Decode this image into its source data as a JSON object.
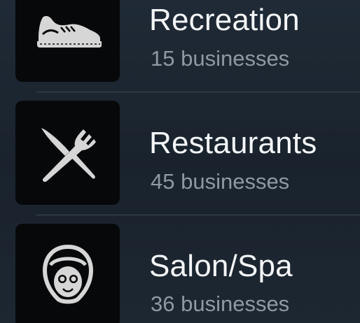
{
  "categories": [
    {
      "title": "Recreation",
      "count": "15 businesses",
      "icon": "shoe-icon"
    },
    {
      "title": "Restaurants",
      "count": "45 businesses",
      "icon": "fork-knife-icon"
    },
    {
      "title": "Salon/Spa",
      "count": "36 businesses",
      "icon": "spa-face-mask-icon"
    }
  ],
  "colors": {
    "background": "#1d2731",
    "tile": "#06080a",
    "icon": "#d6d6d6",
    "title": "#f4f6f8",
    "subtitle": "#8e99a4",
    "divider": "#3b4754"
  }
}
